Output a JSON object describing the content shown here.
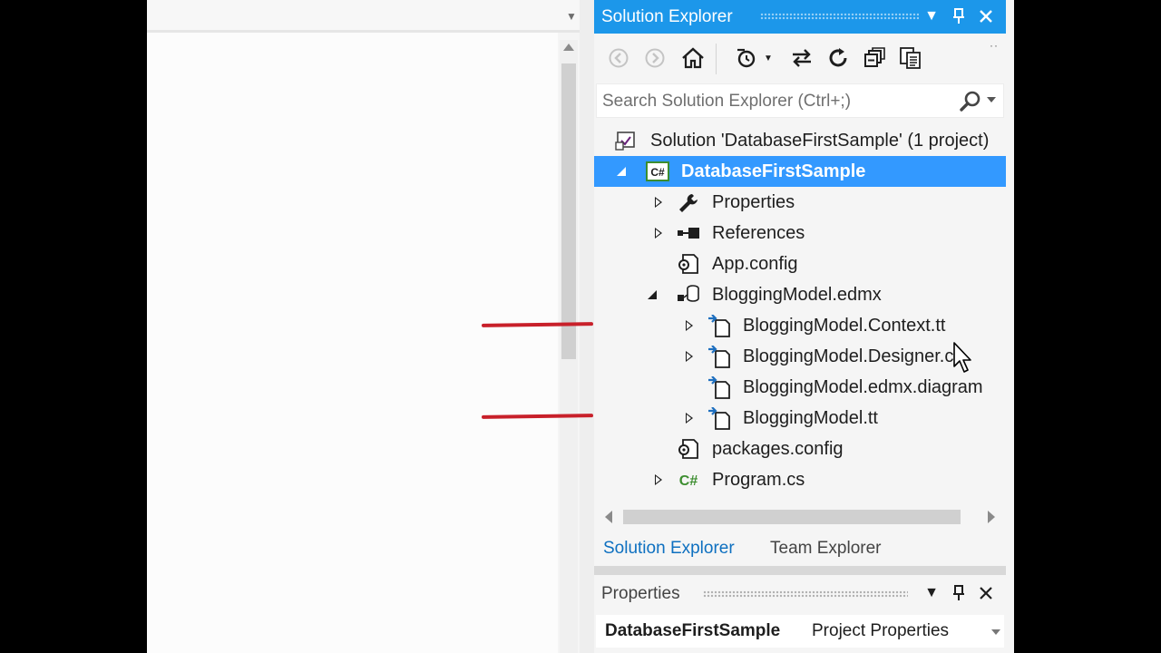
{
  "solution_explorer": {
    "title": "Solution Explorer",
    "search_placeholder": "Search Solution Explorer (Ctrl+;)",
    "tree": [
      {
        "label": "Solution 'DatabaseFirstSample' (1 project)",
        "icon": "solution-icon",
        "expander": "none",
        "selected": false
      },
      {
        "label": "DatabaseFirstSample",
        "icon": "csharp-project-icon",
        "expander": "expanded",
        "selected": true
      },
      {
        "label": "Properties",
        "icon": "wrench-icon",
        "expander": "collapsed",
        "selected": false
      },
      {
        "label": "References",
        "icon": "references-icon",
        "expander": "collapsed",
        "selected": false
      },
      {
        "label": "App.config",
        "icon": "config-file-icon",
        "expander": "none",
        "selected": false
      },
      {
        "label": "BloggingModel.edmx",
        "icon": "edmx-icon",
        "expander": "expanded",
        "selected": false
      },
      {
        "label": "BloggingModel.Context.tt",
        "icon": "tt-file-icon",
        "expander": "collapsed",
        "selected": false
      },
      {
        "label": "BloggingModel.Designer.cs",
        "icon": "tt-file-icon",
        "expander": "collapsed",
        "selected": false
      },
      {
        "label": "BloggingModel.edmx.diagram",
        "icon": "tt-file-icon",
        "expander": "none",
        "selected": false
      },
      {
        "label": "BloggingModel.tt",
        "icon": "tt-file-icon",
        "expander": "collapsed",
        "selected": false
      },
      {
        "label": "packages.config",
        "icon": "config-file-icon",
        "expander": "none",
        "selected": false
      },
      {
        "label": "Program.cs",
        "icon": "csharp-file-icon",
        "expander": "collapsed",
        "selected": false
      }
    ],
    "tabs": [
      {
        "label": "Solution Explorer",
        "active": true
      },
      {
        "label": "Team Explorer",
        "active": false
      }
    ]
  },
  "properties": {
    "title": "Properties",
    "object_name": "DatabaseFirstSample",
    "object_type": "Project Properties"
  },
  "colors": {
    "title_bar": "#1c97ea",
    "selection": "#3399ff",
    "annotation_line": "#c8202a",
    "active_tab_text": "#0e70c0"
  }
}
